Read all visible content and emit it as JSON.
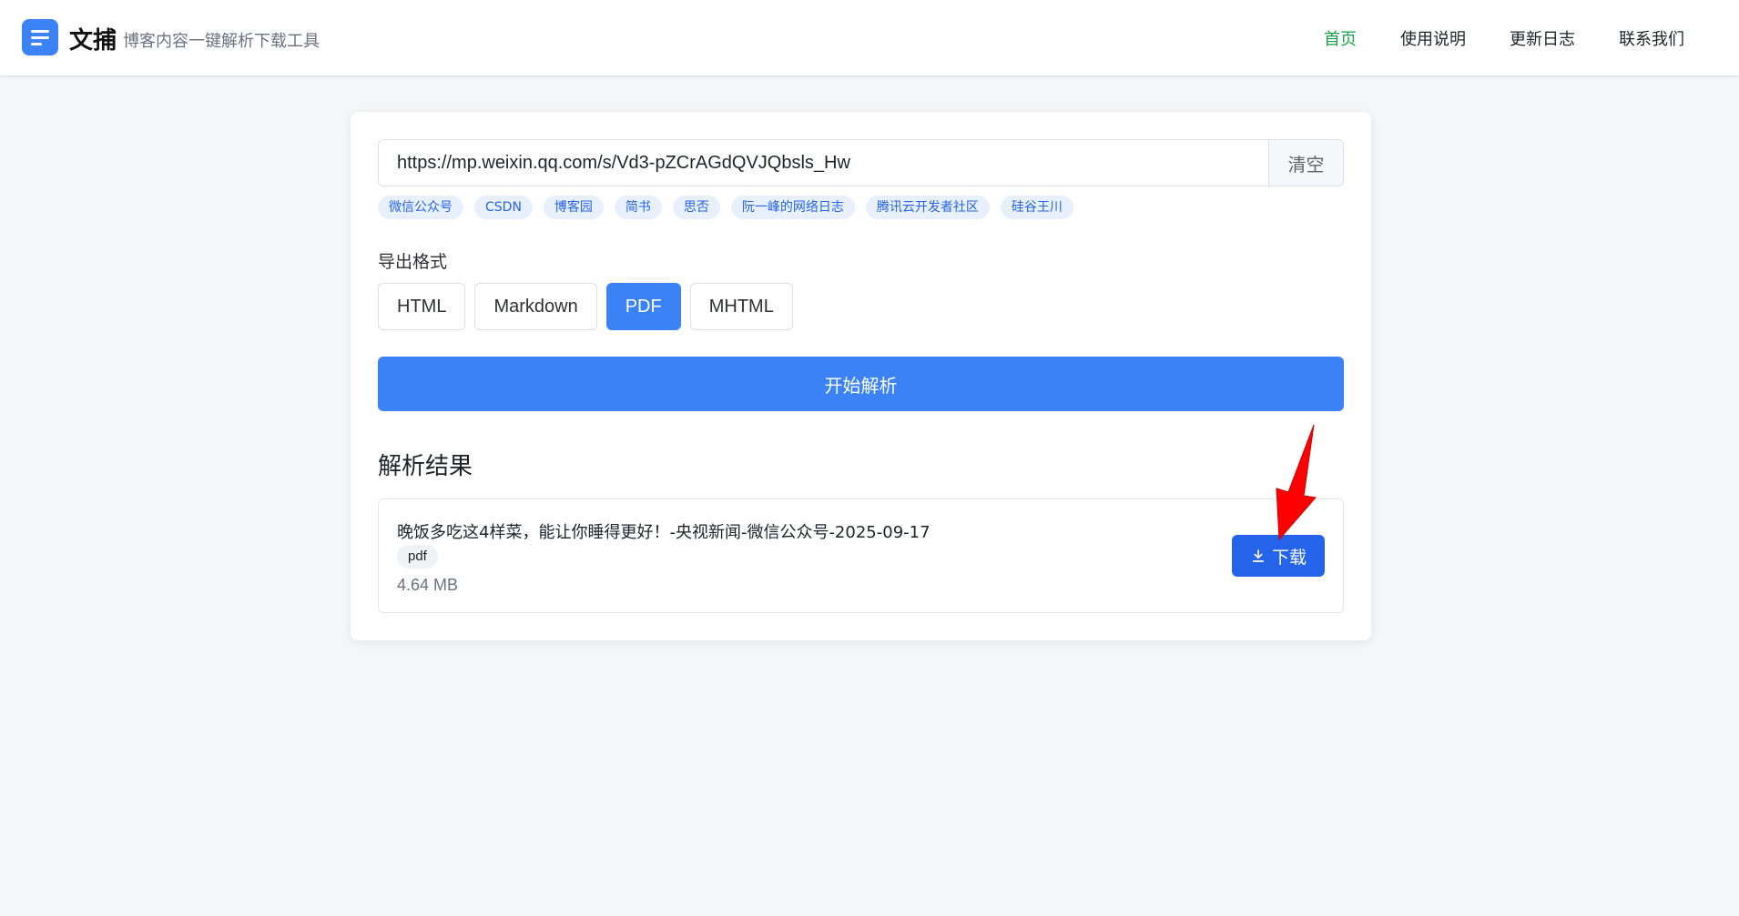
{
  "header": {
    "brand_name": "文捕",
    "brand_subtitle": "博客内容一键解析下载工具",
    "nav": [
      {
        "label": "首页",
        "active": true
      },
      {
        "label": "使用说明",
        "active": false
      },
      {
        "label": "更新日志",
        "active": false
      },
      {
        "label": "联系我们",
        "active": false
      }
    ]
  },
  "search": {
    "url_value": "https://mp.weixin.qq.com/s/Vd3-pZCrAGdQVJQbsls_Hw",
    "clear_label": "清空",
    "sources": [
      "微信公众号",
      "CSDN",
      "博客园",
      "简书",
      "思否",
      "阮一峰的网络日志",
      "腾讯云开发者社区",
      "硅谷王川"
    ]
  },
  "export": {
    "label": "导出格式",
    "formats": [
      {
        "label": "HTML",
        "selected": false
      },
      {
        "label": "Markdown",
        "selected": false
      },
      {
        "label": "PDF",
        "selected": true
      },
      {
        "label": "MHTML",
        "selected": false
      }
    ]
  },
  "actions": {
    "start_label": "开始解析"
  },
  "results": {
    "title": "解析结果",
    "items": [
      {
        "name": "晚饭多吃这4样菜，能让你睡得更好！-央视新闻-微信公众号-2025-09-17",
        "format": "pdf",
        "size": "4.64 MB",
        "download_label": "下载"
      }
    ]
  },
  "colors": {
    "accent": "#3b82f6",
    "download": "#2563eb",
    "nav_active": "#16a34a",
    "tag_bg": "#e8f0fe",
    "annotation_arrow": "#ff0000"
  },
  "icons": {
    "logo": "menu-lines-icon",
    "download": "download-icon",
    "annotation": "red-arrow-icon"
  }
}
